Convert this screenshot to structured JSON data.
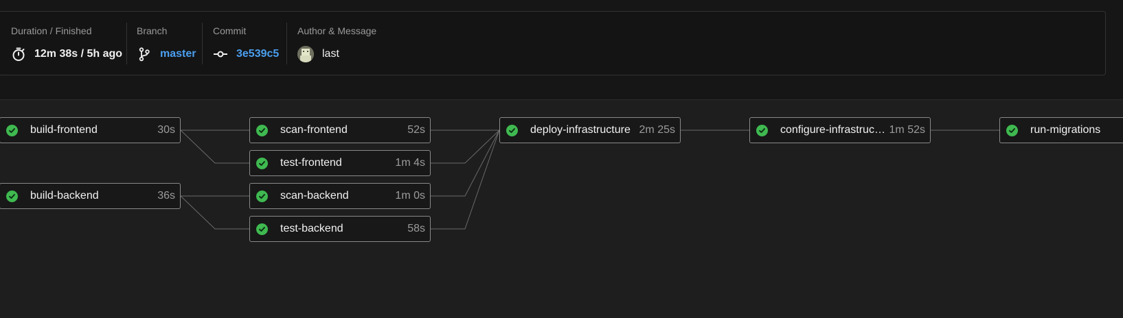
{
  "summary": {
    "duration": {
      "label": "Duration / Finished",
      "value": "12m 38s / 5h ago",
      "icon": "stopwatch-icon"
    },
    "branch": {
      "label": "Branch",
      "value": "master",
      "icon": "git-branch-icon"
    },
    "commit": {
      "label": "Commit",
      "value": "3e539c5",
      "icon": "git-commit-icon"
    },
    "author": {
      "label": "Author & Message",
      "message": "last"
    }
  },
  "jobs": {
    "build_frontend": {
      "name": "build-frontend",
      "duration": "30s",
      "status": "success"
    },
    "build_backend": {
      "name": "build-backend",
      "duration": "36s",
      "status": "success"
    },
    "scan_frontend": {
      "name": "scan-frontend",
      "duration": "52s",
      "status": "success"
    },
    "test_frontend": {
      "name": "test-frontend",
      "duration": "1m 4s",
      "status": "success"
    },
    "scan_backend": {
      "name": "scan-backend",
      "duration": "1m 0s",
      "status": "success"
    },
    "test_backend": {
      "name": "test-backend",
      "duration": "58s",
      "status": "success"
    },
    "deploy_infrastructure": {
      "name": "deploy-infrastructure",
      "duration": "2m 25s",
      "status": "success"
    },
    "configure_infrastructure": {
      "name": "configure-infrastructure",
      "duration": "1m 52s",
      "status": "success"
    },
    "run_migrations": {
      "name": "run-migrations",
      "duration": "",
      "status": "success"
    }
  },
  "colors": {
    "success": "#3fb950",
    "link": "#4b9fef",
    "background": "#1e1e1e"
  }
}
